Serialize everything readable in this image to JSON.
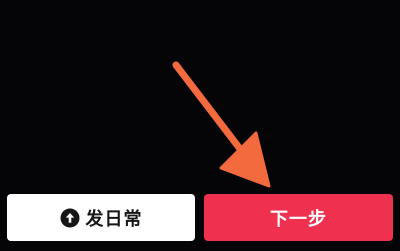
{
  "actions": {
    "daily_label": "发日常",
    "next_label": "下一步"
  },
  "colors": {
    "background": "#050406",
    "daily_button_bg": "#ffffff",
    "next_button_bg": "#f0304f",
    "annotation_arrow": "#f26a3d"
  },
  "icons": {
    "daily": "circle-arrow-up-icon",
    "annotation": "pointer-arrow-icon"
  }
}
